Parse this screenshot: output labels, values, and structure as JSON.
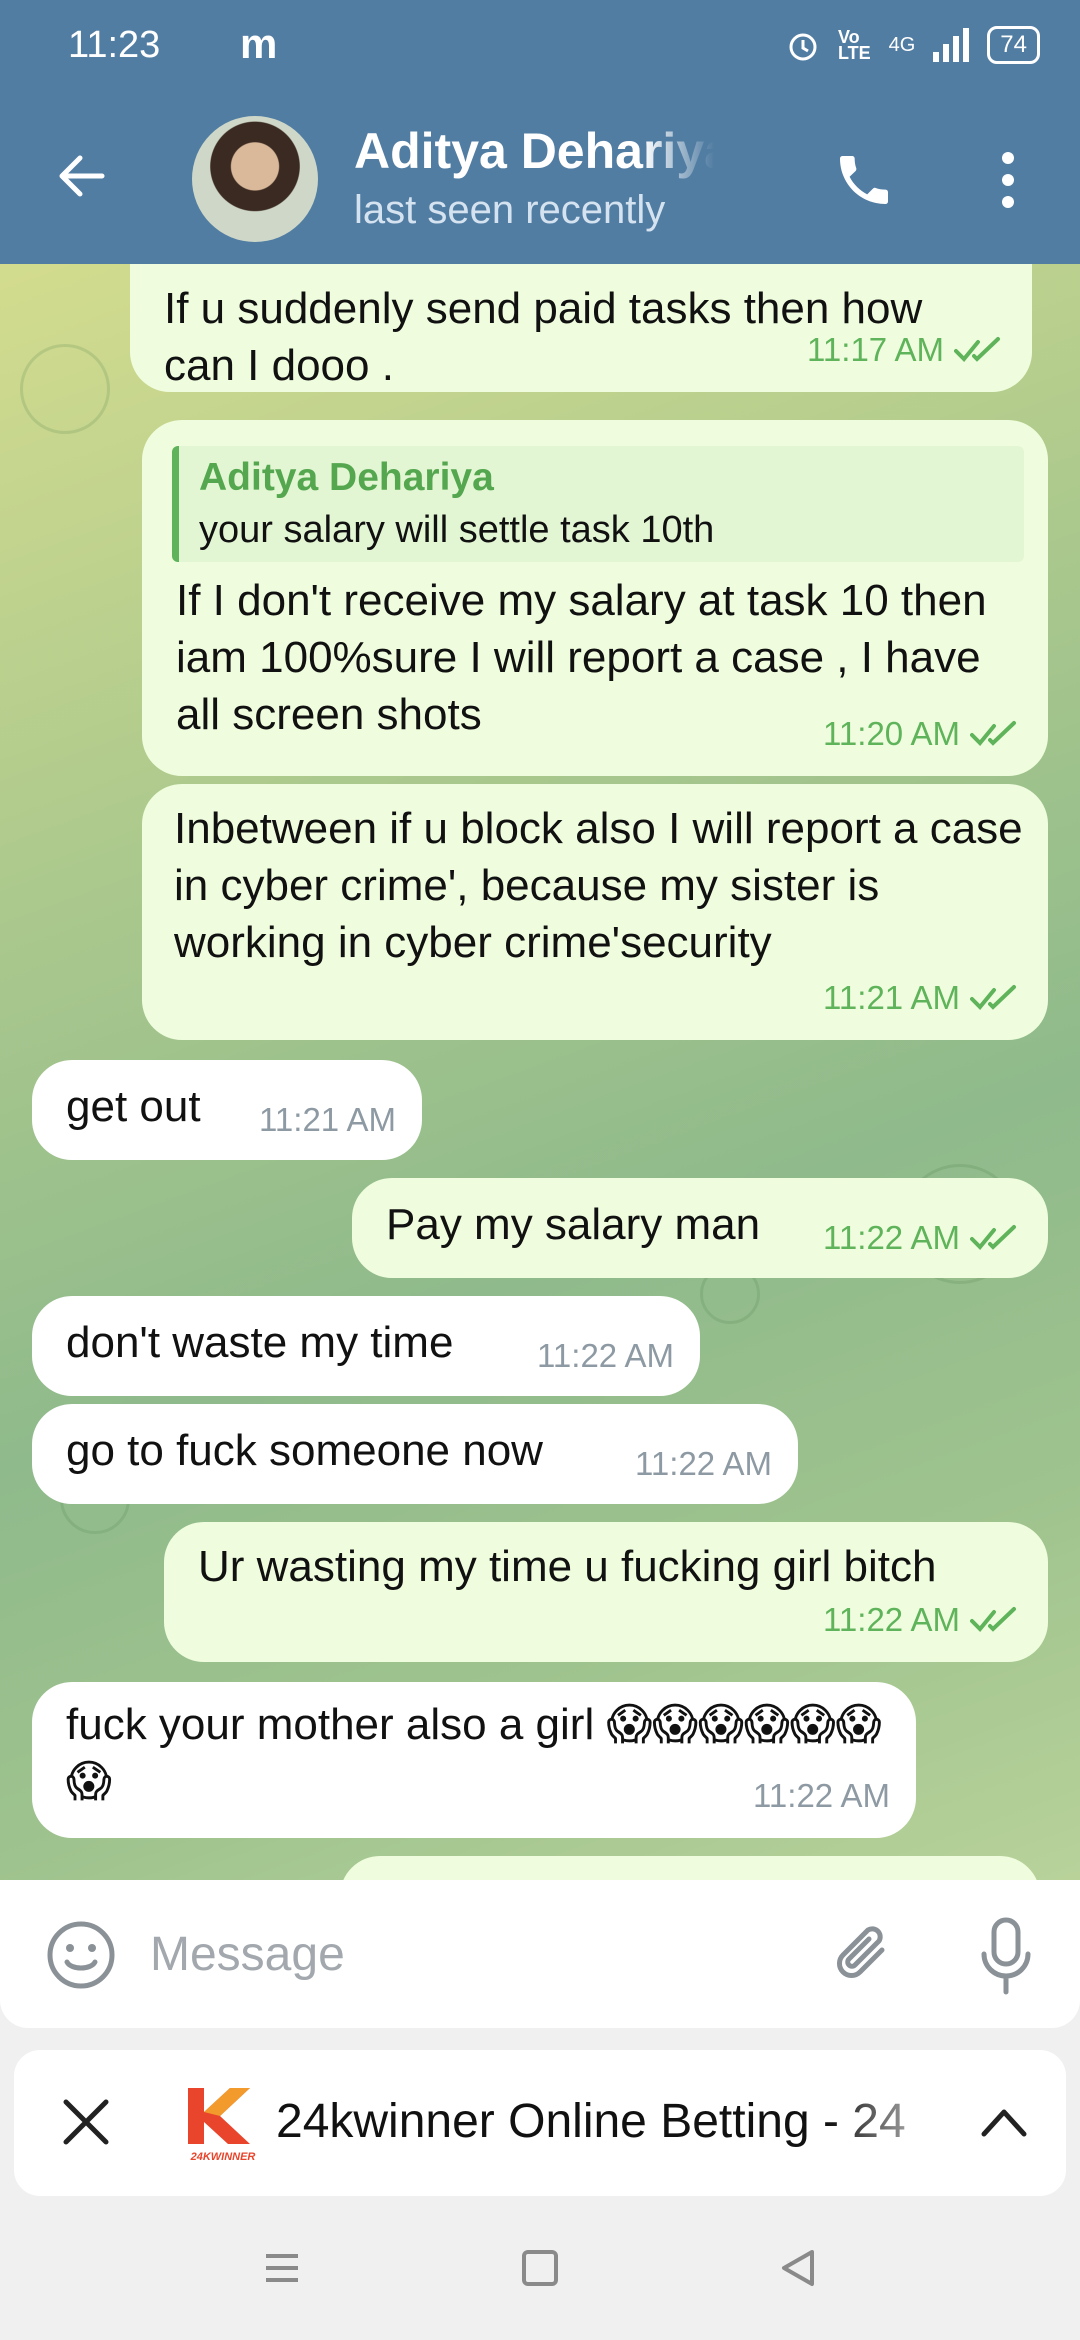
{
  "status_bar": {
    "time": "11:23",
    "app_badge": "m",
    "network": "4G",
    "battery": "74"
  },
  "header": {
    "contact_name": "Aditya Dehariya",
    "contact_status": "last seen recently"
  },
  "messages": [
    {
      "direction": "out",
      "text": "If u suddenly send  paid tasks then how can I dooo .",
      "time": "11:17 AM",
      "read": true
    },
    {
      "direction": "out",
      "reply_to_name": "Aditya Dehariya",
      "reply_to_text": "your salary will settle task 10th",
      "text": "If I don't receive my salary at task 10 then iam 100%sure I will report a case , I have all screen shots",
      "time": "11:20 AM",
      "read": true
    },
    {
      "direction": "out",
      "text": "Inbetween if u block also I will report a case in cyber crime', because my sister is working in cyber crime'security",
      "time": "11:21 AM",
      "read": true
    },
    {
      "direction": "in",
      "text": "get out",
      "time": "11:21 AM"
    },
    {
      "direction": "out",
      "text": "Pay my salary man",
      "time": "11:22 AM",
      "read": true
    },
    {
      "direction": "in",
      "text": "don't waste my time",
      "time": "11:22 AM"
    },
    {
      "direction": "in",
      "text": "go to fuck someone now",
      "time": "11:22 AM"
    },
    {
      "direction": "out",
      "text": "Ur wasting my time u fucking girl bitch",
      "time": "11:22 AM",
      "read": true
    },
    {
      "direction": "in",
      "text": "fuck your mother also a girl 😱😱😱😱😱😱😱",
      "time": "11:22 AM"
    }
  ],
  "composer": {
    "placeholder": "Message"
  },
  "ad_bar": {
    "title": "24kwinner Online Betting - 24",
    "logo_text": "24KWINNER"
  },
  "colors": {
    "header": "#527da3",
    "outgoing_bubble": "#effdde",
    "incoming_bubble": "#ffffff",
    "accent_green": "#5fb35a"
  }
}
